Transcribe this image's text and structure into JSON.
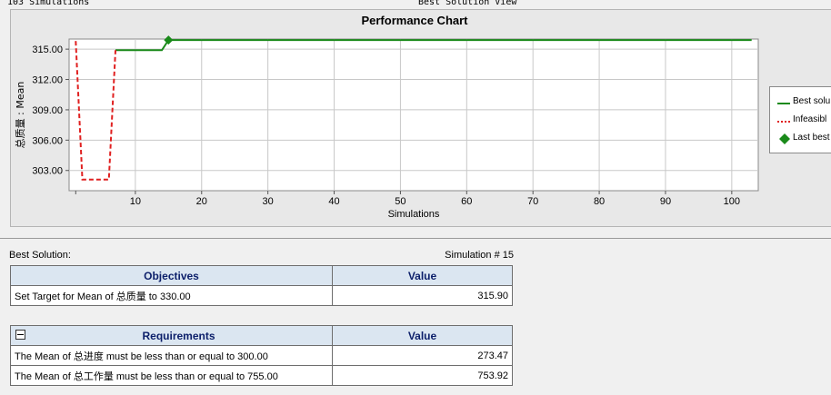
{
  "header": {
    "left_text": "103 Simulations",
    "center_text": "Best Solution View"
  },
  "chart_data": {
    "type": "line",
    "title": "Performance Chart",
    "xlabel": "Simulations",
    "ylabel": "总质量 : Mean",
    "x_ticks": [
      10,
      20,
      30,
      40,
      50,
      60,
      70,
      80,
      90,
      100
    ],
    "y_ticks": [
      "303.00",
      "306.00",
      "309.00",
      "312.00",
      "315.00"
    ],
    "xlim": [
      0,
      104
    ],
    "ylim": [
      301.0,
      316.0
    ],
    "grid": true,
    "legend_position": "right",
    "series": [
      {
        "name": "Best solution",
        "style": "solid",
        "color": "#1a8a1a",
        "points": [
          [
            7,
            314.9
          ],
          [
            14,
            314.9
          ],
          [
            15,
            315.9
          ],
          [
            103,
            315.9
          ]
        ]
      },
      {
        "name": "Infeasible",
        "style": "dashed",
        "color": "#e02020",
        "points": [
          [
            1,
            315.8
          ],
          [
            2,
            302.1
          ],
          [
            6,
            302.1
          ],
          [
            7,
            314.9
          ]
        ]
      },
      {
        "name": "Last best",
        "style": "marker",
        "color": "#1a8a1a",
        "points": [
          [
            15,
            315.9
          ]
        ]
      }
    ],
    "legend": [
      "Best solu",
      "Infeasibl",
      "Last best"
    ]
  },
  "best_solution": {
    "label": "Best Solution:",
    "simulation": "Simulation # 15"
  },
  "objectives": {
    "headers": [
      "Objectives",
      "Value"
    ],
    "rows": [
      [
        "Set Target for Mean of 总质量 to 330.00",
        "315.90"
      ]
    ]
  },
  "requirements": {
    "headers": [
      "Requirements",
      "Value"
    ],
    "rows": [
      [
        "The Mean of 总进度 must be less than or equal to 300.00",
        "273.47"
      ],
      [
        "The Mean of 总工作量 must be less than or equal to 755.00",
        "753.92"
      ]
    ]
  }
}
